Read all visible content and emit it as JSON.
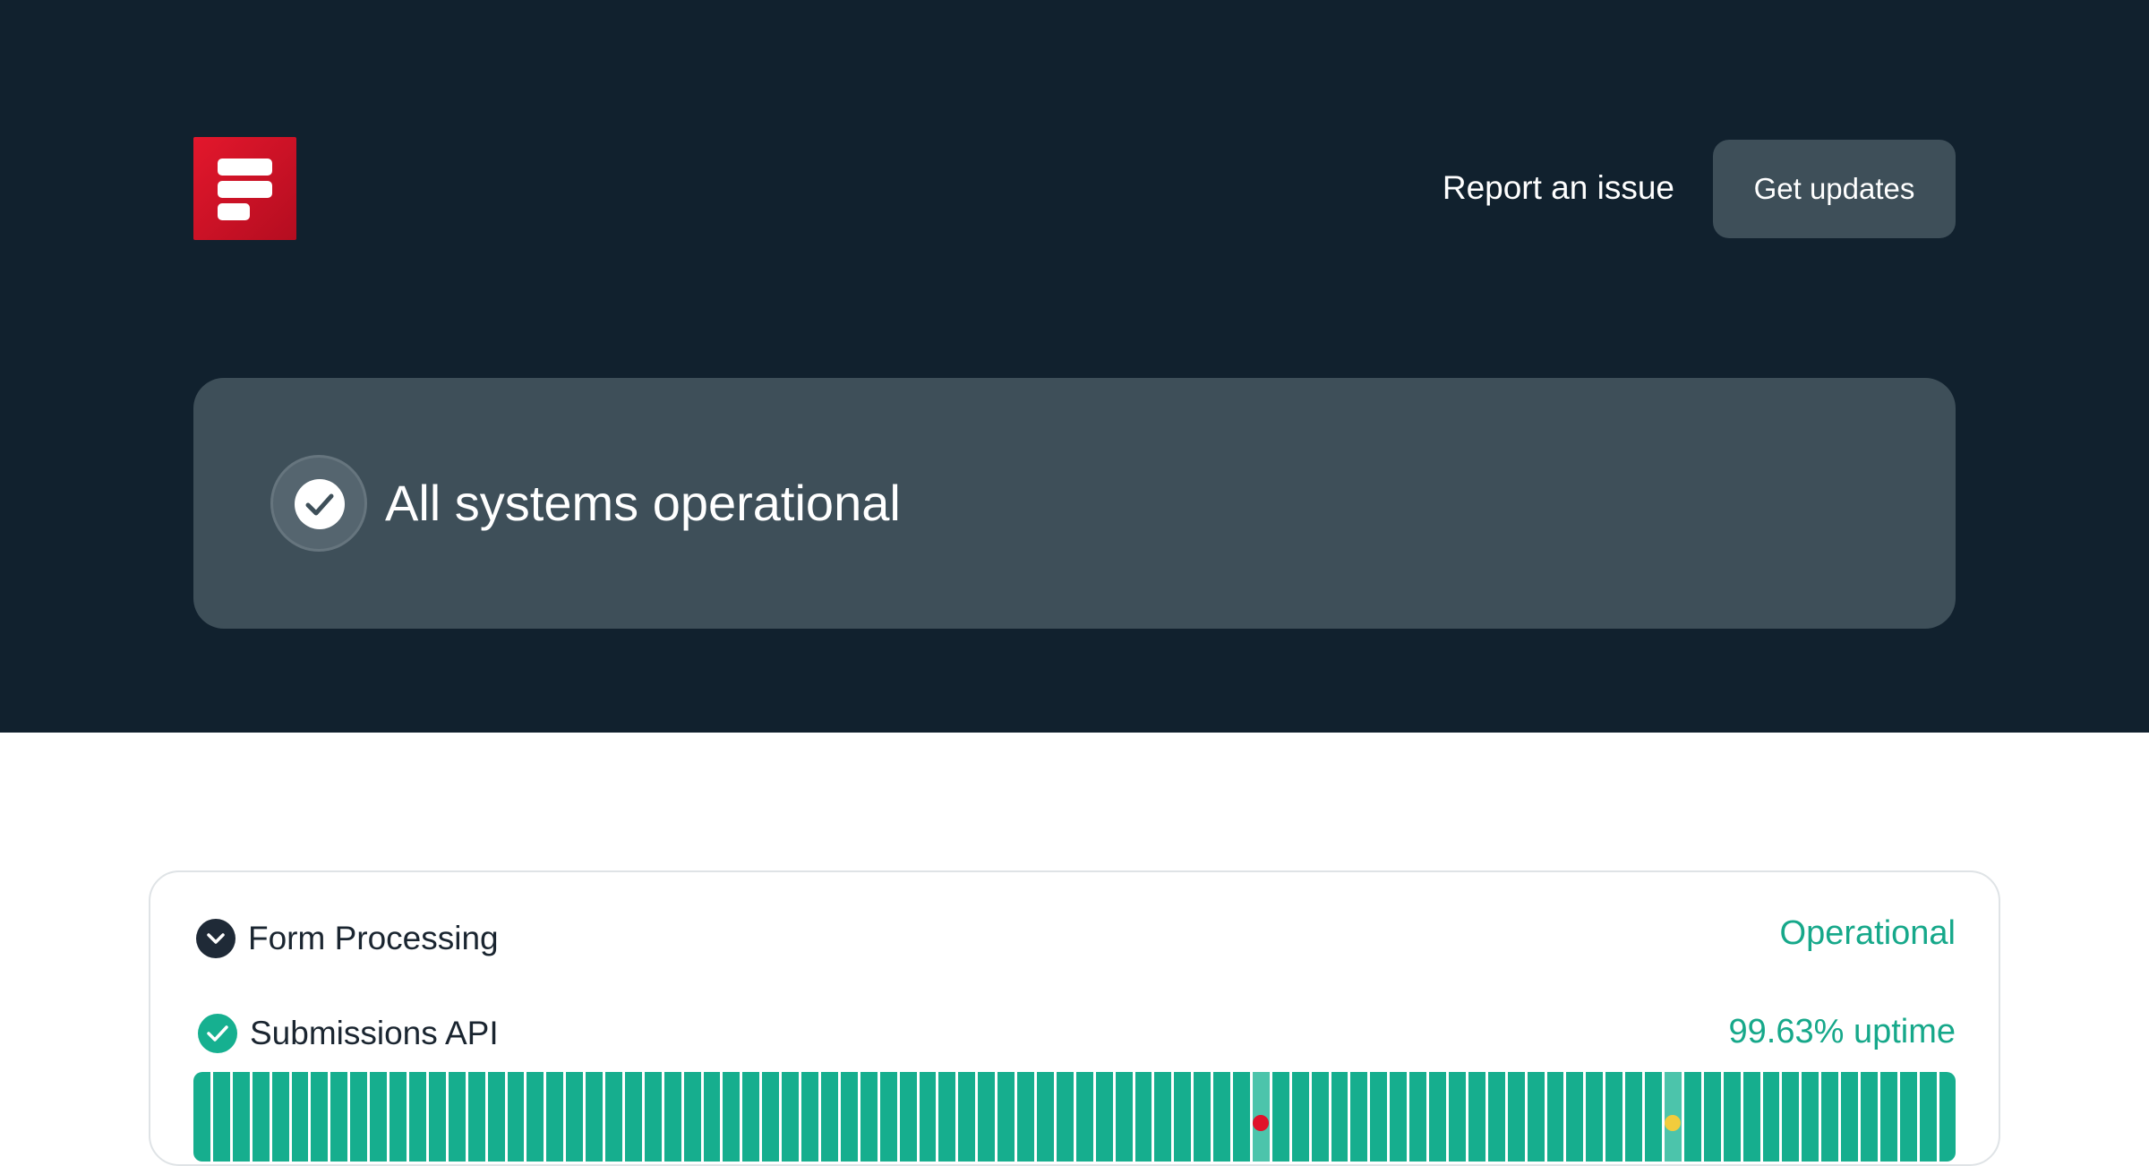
{
  "header": {
    "logo_icon": "form-logo-icon",
    "report_label": "Report an issue",
    "updates_label": "Get updates"
  },
  "status_banner": {
    "icon": "check-circle-icon",
    "title": "All systems operational"
  },
  "components": {
    "group": {
      "name": "Form Processing",
      "status": "Operational",
      "icon": "chevron-down-icon"
    },
    "items": [
      {
        "name": "Submissions API",
        "uptime": "99.63% uptime",
        "icon": "check-circle-icon",
        "history_days": 90,
        "incident_days": [
          {
            "index": 54,
            "level": "major"
          },
          {
            "index": 75,
            "level": "minor"
          }
        ]
      }
    ]
  },
  "colors": {
    "hero_background": "#11212e",
    "card_background": "#3e4f59",
    "operational": "#16ae8e",
    "major_outage": "#e0122a",
    "degraded": "#f2cc3d",
    "brand_red": "#d9132a"
  }
}
